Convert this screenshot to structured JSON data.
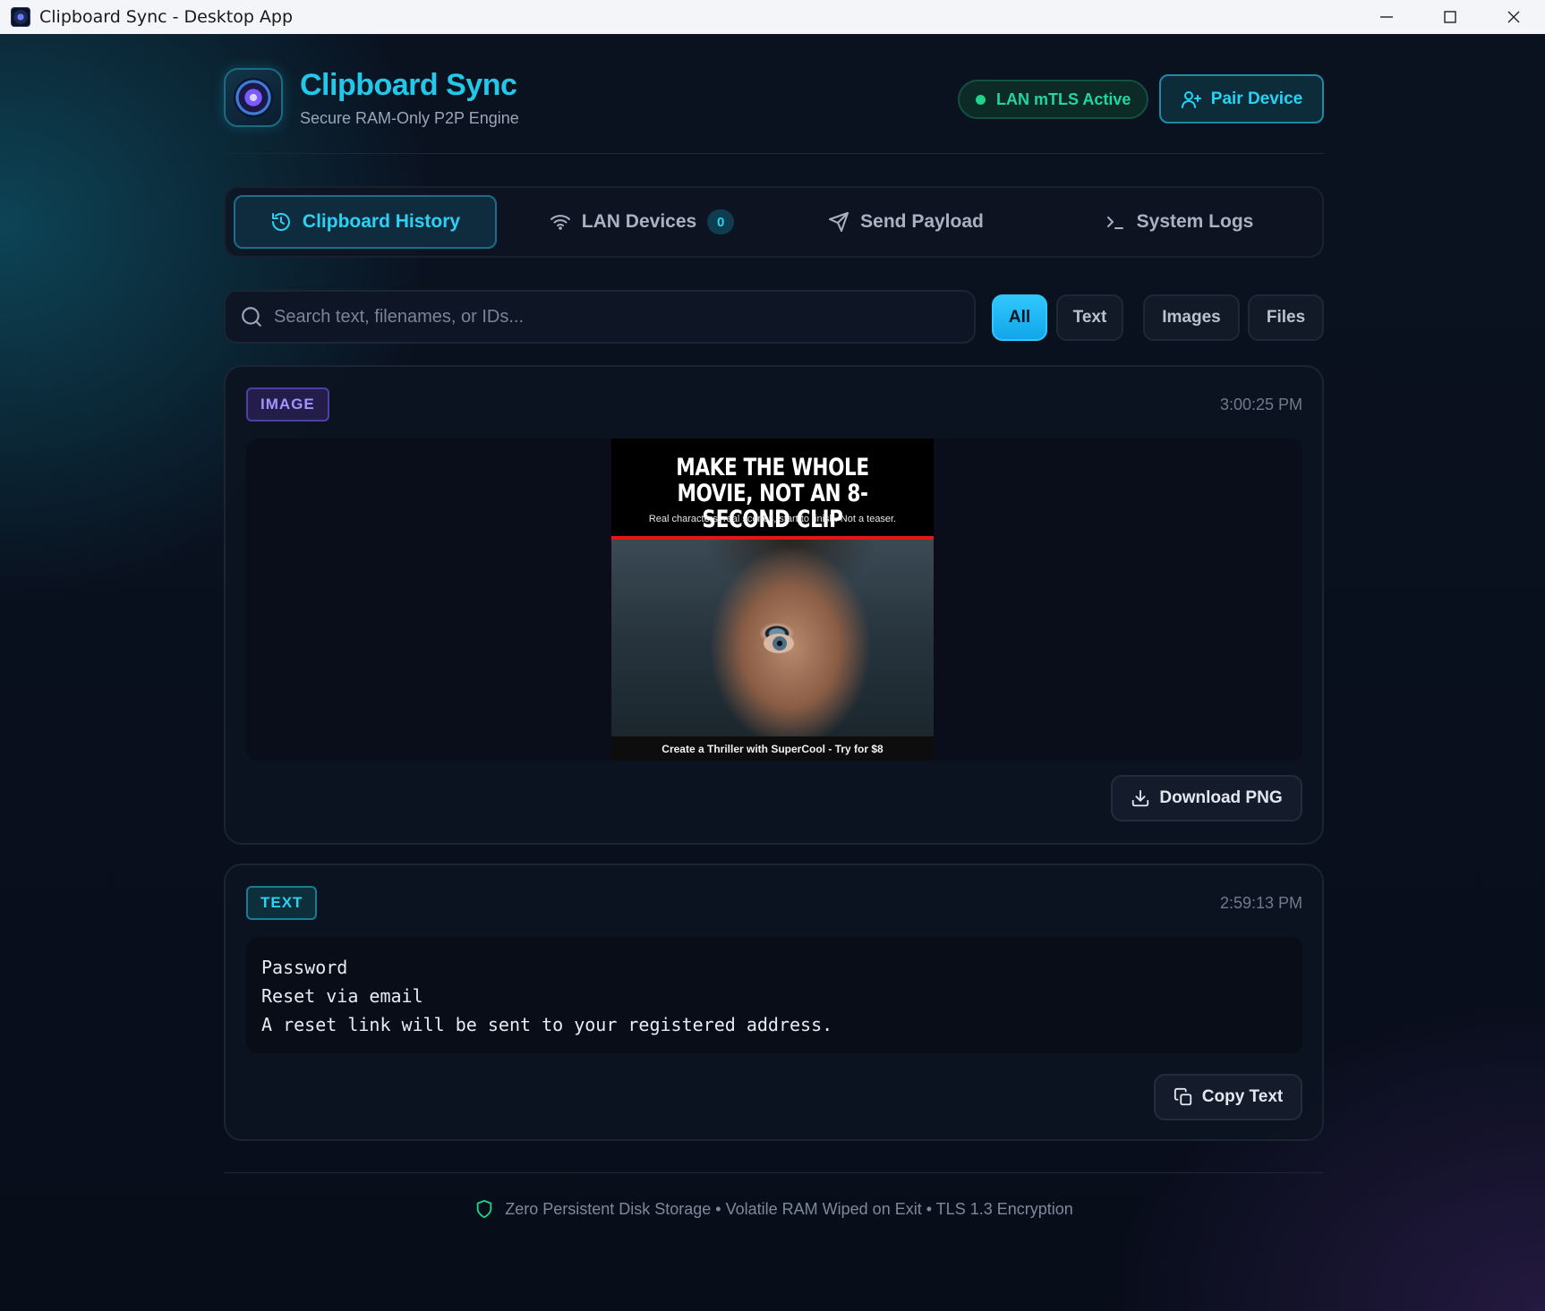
{
  "window": {
    "title": "Clipboard Sync - Desktop App"
  },
  "header": {
    "app_title": "Clipboard Sync",
    "subtitle": "Secure RAM-Only P2P Engine",
    "status": "LAN mTLS Active",
    "pair_button": "Pair Device"
  },
  "tabs": [
    {
      "label": "Clipboard History",
      "icon": "history-icon",
      "active": true
    },
    {
      "label": "LAN Devices",
      "icon": "wifi-icon",
      "badge": "0"
    },
    {
      "label": "Send Payload",
      "icon": "send-icon"
    },
    {
      "label": "System Logs",
      "icon": "terminal-icon"
    }
  ],
  "search": {
    "placeholder": "Search text, filenames, or IDs..."
  },
  "filters": [
    {
      "label": "All",
      "active": true
    },
    {
      "label": "Text"
    },
    {
      "label": "Images"
    },
    {
      "label": "Files"
    }
  ],
  "items": [
    {
      "type": "IMAGE",
      "timestamp": "3:00:25 PM",
      "preview": {
        "headline": "MAKE THE WHOLE MOVIE, NOT AN 8-SECOND CLIP",
        "subline": "Real characters, real scenes, start to finish. Not a teaser.",
        "footer": "Create a Thriller with SuperCool - Try for $8"
      },
      "action": "Download PNG"
    },
    {
      "type": "TEXT",
      "timestamp": "2:59:13 PM",
      "lines": [
        "Password",
        "Reset via email",
        "A reset link will be sent to your registered address."
      ],
      "action": "Copy Text"
    }
  ],
  "footer": {
    "text": "Zero Persistent Disk Storage • Volatile RAM Wiped on Exit • TLS 1.3 Encryption"
  },
  "colors": {
    "accent": "#2ad2f5",
    "status_green": "#22d6a0",
    "image_badge": "#a693ff",
    "filter_active": "#2fc7ff"
  }
}
